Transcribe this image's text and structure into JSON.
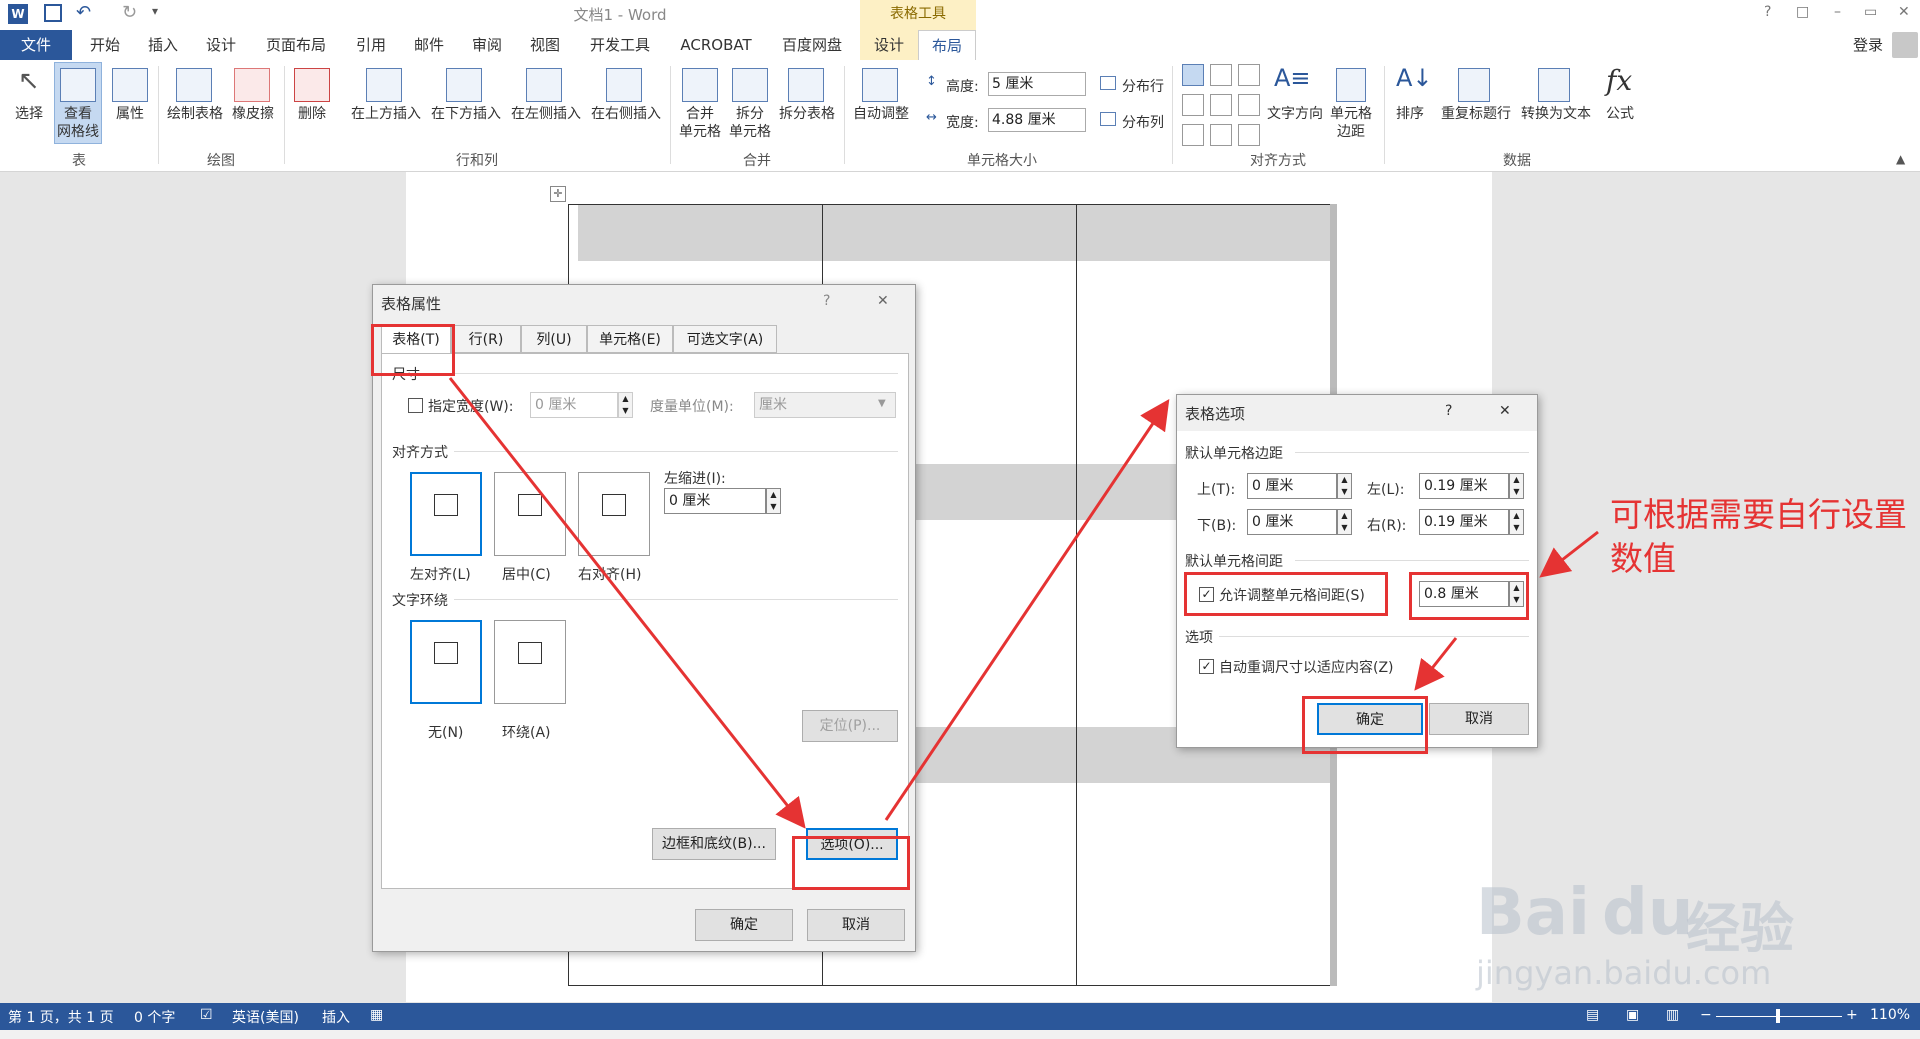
{
  "titlebar": {
    "doc_title": "文档1 - Word",
    "context_tab": "表格工具",
    "help": "?",
    "restore": "□",
    "minimize": "–",
    "maximize": "▭",
    "close": "✕"
  },
  "tabs": {
    "file": "文件",
    "items": [
      "开始",
      "插入",
      "设计",
      "页面布局",
      "引用",
      "邮件",
      "审阅",
      "视图",
      "开发工具",
      "ACROBAT",
      "百度网盘"
    ],
    "ctx_design": "设计",
    "ctx_layout": "布局",
    "login": "登录"
  },
  "ribbon": {
    "table_group": {
      "select": "选择",
      "gridlines_1": "查看",
      "gridlines_2": "网格线",
      "properties": "属性",
      "label": "表"
    },
    "draw_group": {
      "draw": "绘制表格",
      "eraser": "橡皮擦",
      "label": "绘图"
    },
    "rows_group": {
      "delete": "删除",
      "insert_above": "在上方插入",
      "insert_below": "在下方插入",
      "insert_left": "在左侧插入",
      "insert_right": "在右侧插入",
      "label": "行和列"
    },
    "merge_group": {
      "merge_1": "合并",
      "merge_2": "单元格",
      "split_1": "拆分",
      "split_2": "单元格",
      "split_table": "拆分表格",
      "label": "合并"
    },
    "size_group": {
      "autofit": "自动调整",
      "height_label": "高度:",
      "height_value": "5 厘米",
      "width_label": "宽度:",
      "width_value": "4.88 厘米",
      "dist_rows": "分布行",
      "dist_cols": "分布列",
      "label": "单元格大小"
    },
    "align_group": {
      "text_dir": "文字方向",
      "margins_1": "单元格",
      "margins_2": "边距",
      "label": "对齐方式"
    },
    "data_group": {
      "sort": "排序",
      "repeat_header": "重复标题行",
      "convert": "转换为文本",
      "formula": "公式",
      "label": "数据"
    }
  },
  "table_props": {
    "title": "表格属性",
    "help": "?",
    "close": "✕",
    "tabs": [
      "表格(T)",
      "行(R)",
      "列(U)",
      "单元格(E)",
      "可选文字(A)"
    ],
    "size_section": "尺寸",
    "pref_width_label": "指定宽度(W):",
    "pref_width_value": "0 厘米",
    "measure_label": "度量单位(M):",
    "measure_value": "厘米",
    "align_section": "对齐方式",
    "align_left": "左对齐(L)",
    "align_center": "居中(C)",
    "align_right": "右对齐(H)",
    "indent_label": "左缩进(I):",
    "indent_value": "0 厘米",
    "wrap_section": "文字环绕",
    "wrap_none": "无(N)",
    "wrap_around": "环绕(A)",
    "position_btn": "定位(P)...",
    "borders_btn": "边框和底纹(B)...",
    "options_btn": "选项(O)...",
    "ok": "确定",
    "cancel": "取消"
  },
  "table_options": {
    "title": "表格选项",
    "help": "?",
    "close": "✕",
    "margins_section": "默认单元格边距",
    "top_label": "上(T):",
    "top_value": "0 厘米",
    "left_label": "左(L):",
    "left_value": "0.19 厘米",
    "bottom_label": "下(B):",
    "bottom_value": "0 厘米",
    "right_label": "右(R):",
    "right_value": "0.19 厘米",
    "spacing_section": "默认单元格间距",
    "allow_spacing": "允许调整单元格间距(S)",
    "spacing_value": "0.8 厘米",
    "options_section": "选项",
    "autoresize": "自动重调尺寸以适应内容(Z)",
    "ok": "确定",
    "cancel": "取消"
  },
  "annotation": {
    "line1": "可根据需要自行设置",
    "line2": "数值"
  },
  "watermark": {
    "logo": "Bai",
    "logo2": "du",
    "brand": "经验",
    "url": "jingyan.baidu.com"
  },
  "status": {
    "page": "第 1 页，共 1 页",
    "words": "0 个字",
    "lang": "英语(美国)",
    "mode": "插入",
    "zoom": "110%"
  },
  "colors": {
    "accent": "#2b579a",
    "highlight": "#e53333",
    "context": "#fdf0c5"
  }
}
